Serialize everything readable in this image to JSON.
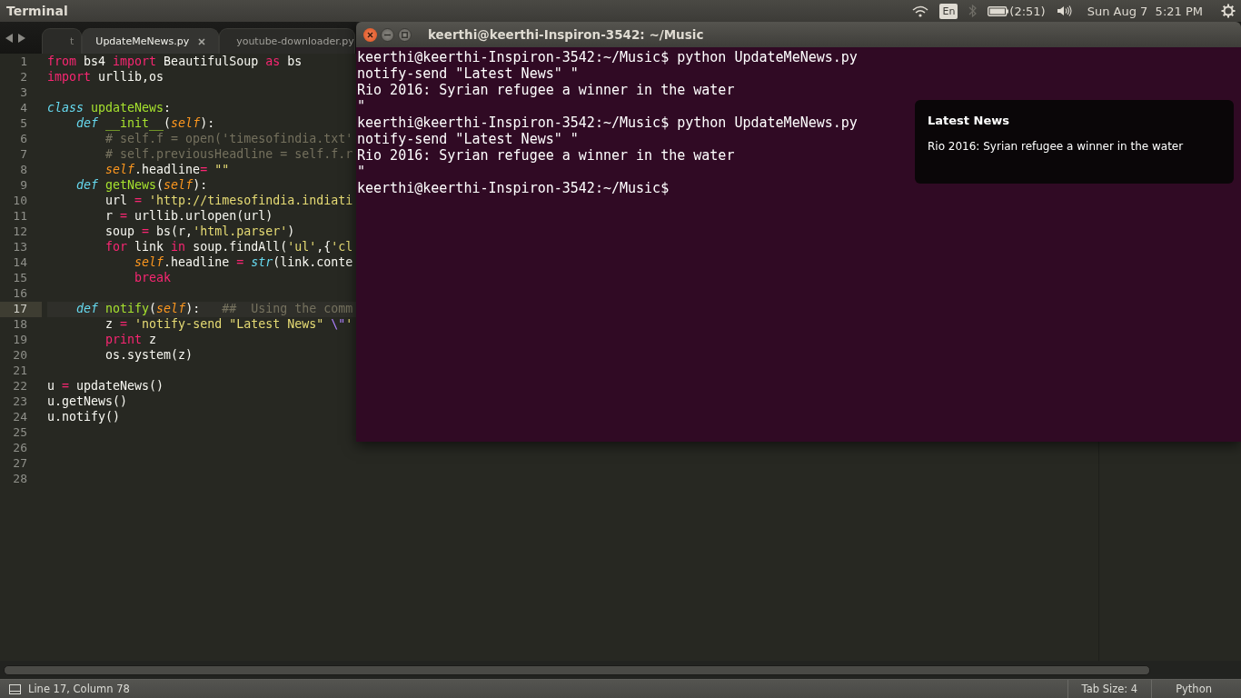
{
  "top_panel": {
    "app_title": "Terminal",
    "keyboard_layout": "En",
    "battery_time": "(2:51)",
    "clock": "Sun Aug 7  5:21 PM"
  },
  "editor": {
    "tabs": [
      {
        "label": "t",
        "selected": false
      },
      {
        "label": "UpdateMeNews.py",
        "selected": true
      },
      {
        "label": "youtube-downloader.py",
        "selected": false
      }
    ],
    "lines": [
      {
        "number": "1",
        "current": false,
        "tokens": [
          {
            "kind": "keyword",
            "text": "from"
          },
          {
            "kind": "plain",
            "text": " bs4 "
          },
          {
            "kind": "keyword",
            "text": "import"
          },
          {
            "kind": "plain",
            "text": " BeautifulSoup "
          },
          {
            "kind": "keyword",
            "text": "as"
          },
          {
            "kind": "plain",
            "text": " bs"
          }
        ]
      },
      {
        "number": "2",
        "current": false,
        "tokens": [
          {
            "kind": "keyword",
            "text": "import"
          },
          {
            "kind": "plain",
            "text": " urllib,os"
          }
        ]
      },
      {
        "number": "3",
        "current": false
      },
      {
        "number": "4",
        "current": false,
        "tokens": [
          {
            "kind": "storage",
            "text": "class "
          },
          {
            "kind": "entity",
            "text": "updateNews"
          },
          {
            "kind": "plain",
            "text": ":"
          }
        ]
      },
      {
        "number": "5",
        "current": false,
        "tokens": [
          {
            "kind": "storage",
            "text": "    def "
          },
          {
            "kind": "entity",
            "text": "__init__"
          },
          {
            "kind": "plain",
            "text": "("
          },
          {
            "kind": "param",
            "text": "self"
          },
          {
            "kind": "plain",
            "text": "):"
          }
        ]
      },
      {
        "number": "6",
        "current": false,
        "tokens": [
          {
            "kind": "comment",
            "text": "        # self.f = open('timesofindia.txt'"
          }
        ]
      },
      {
        "number": "7",
        "current": false,
        "tokens": [
          {
            "kind": "comment",
            "text": "        # self.previousHeadline = self.f.r"
          }
        ]
      },
      {
        "number": "8",
        "current": false,
        "tokens": [
          {
            "kind": "param",
            "text": "        self"
          },
          {
            "kind": "plain",
            "text": ".headline"
          },
          {
            "kind": "keyword",
            "text": "="
          },
          {
            "kind": "string",
            "text": " \"\""
          }
        ]
      },
      {
        "number": "9",
        "current": false,
        "tokens": [
          {
            "kind": "storage",
            "text": "    def "
          },
          {
            "kind": "entity",
            "text": "getNews"
          },
          {
            "kind": "plain",
            "text": "("
          },
          {
            "kind": "param",
            "text": "self"
          },
          {
            "kind": "plain",
            "text": "):"
          }
        ]
      },
      {
        "number": "10",
        "current": false,
        "tokens": [
          {
            "kind": "plain",
            "text": "        url "
          },
          {
            "kind": "keyword",
            "text": "="
          },
          {
            "kind": "string",
            "text": " 'http://timesofindia.indiati"
          }
        ]
      },
      {
        "number": "11",
        "current": false,
        "tokens": [
          {
            "kind": "plain",
            "text": "        r "
          },
          {
            "kind": "keyword",
            "text": "="
          },
          {
            "kind": "plain",
            "text": " urllib.urlopen(url)"
          }
        ]
      },
      {
        "number": "12",
        "current": false,
        "tokens": [
          {
            "kind": "plain",
            "text": "        soup "
          },
          {
            "kind": "keyword",
            "text": "="
          },
          {
            "kind": "plain",
            "text": " bs(r,"
          },
          {
            "kind": "string",
            "text": "'html.parser'"
          },
          {
            "kind": "plain",
            "text": ")"
          }
        ]
      },
      {
        "number": "13",
        "current": false,
        "tokens": [
          {
            "kind": "keyword",
            "text": "        for"
          },
          {
            "kind": "plain",
            "text": " link "
          },
          {
            "kind": "keyword",
            "text": "in"
          },
          {
            "kind": "plain",
            "text": " soup.findAll("
          },
          {
            "kind": "string",
            "text": "'ul'"
          },
          {
            "kind": "plain",
            "text": ",{"
          },
          {
            "kind": "string",
            "text": "'cl"
          }
        ]
      },
      {
        "number": "14",
        "current": false,
        "tokens": [
          {
            "kind": "param",
            "text": "            self"
          },
          {
            "kind": "plain",
            "text": ".headline "
          },
          {
            "kind": "keyword",
            "text": "="
          },
          {
            "kind": "builtin",
            "text": " str"
          },
          {
            "kind": "plain",
            "text": "(link.conte"
          }
        ]
      },
      {
        "number": "15",
        "current": false,
        "tokens": [
          {
            "kind": "keyword",
            "text": "            break"
          }
        ]
      },
      {
        "number": "16",
        "current": false
      },
      {
        "number": "17",
        "current": true,
        "tokens": [
          {
            "kind": "storage",
            "text": "    def "
          },
          {
            "kind": "entity",
            "text": "notify"
          },
          {
            "kind": "plain",
            "text": "("
          },
          {
            "kind": "param",
            "text": "self"
          },
          {
            "kind": "plain",
            "text": "):   "
          },
          {
            "kind": "comment",
            "text": "##  Using the comm"
          }
        ]
      },
      {
        "number": "18",
        "current": false,
        "tokens": [
          {
            "kind": "plain",
            "text": "        z "
          },
          {
            "kind": "keyword",
            "text": "="
          },
          {
            "kind": "string",
            "text": " 'notify-send \"Latest News\" "
          },
          {
            "kind": "escape",
            "text": "\\\""
          },
          {
            "kind": "string",
            "text": "'"
          }
        ]
      },
      {
        "number": "19",
        "current": false,
        "tokens": [
          {
            "kind": "keyword",
            "text": "        print"
          },
          {
            "kind": "plain",
            "text": " z"
          }
        ]
      },
      {
        "number": "20",
        "current": false,
        "tokens": [
          {
            "kind": "plain",
            "text": "        os.system(z)"
          }
        ]
      },
      {
        "number": "21",
        "current": false
      },
      {
        "number": "22",
        "current": false,
        "tokens": [
          {
            "kind": "plain",
            "text": "u "
          },
          {
            "kind": "keyword",
            "text": "="
          },
          {
            "kind": "plain",
            "text": " updateNews()"
          }
        ]
      },
      {
        "number": "23",
        "current": false,
        "tokens": [
          {
            "kind": "plain",
            "text": "u.getNews()"
          }
        ]
      },
      {
        "number": "24",
        "current": false,
        "tokens": [
          {
            "kind": "plain",
            "text": "u.notify()"
          }
        ]
      },
      {
        "number": "25",
        "current": false
      },
      {
        "number": "26",
        "current": false
      },
      {
        "number": "27",
        "current": false
      },
      {
        "number": "28",
        "current": false
      }
    ],
    "status_bar": {
      "position": "Line 17, Column 78",
      "tab_size": "Tab Size: 4",
      "syntax": "Python"
    }
  },
  "terminal": {
    "title": "keerthi@keerthi-Inspiron-3542: ~/Music",
    "lines": [
      "keerthi@keerthi-Inspiron-3542:~/Music$ python UpdateMeNews.py",
      "notify-send \"Latest News\" \"",
      "Rio 2016: Syrian refugee a winner in the water",
      "\"",
      "keerthi@keerthi-Inspiron-3542:~/Music$ python UpdateMeNews.py",
      "notify-send \"Latest News\" \"",
      "Rio 2016: Syrian refugee a winner in the water",
      "\"",
      "keerthi@keerthi-Inspiron-3542:~/Music$"
    ]
  },
  "notification": {
    "title": "Latest News",
    "body": "Rio 2016: Syrian refugee a winner in the water"
  }
}
